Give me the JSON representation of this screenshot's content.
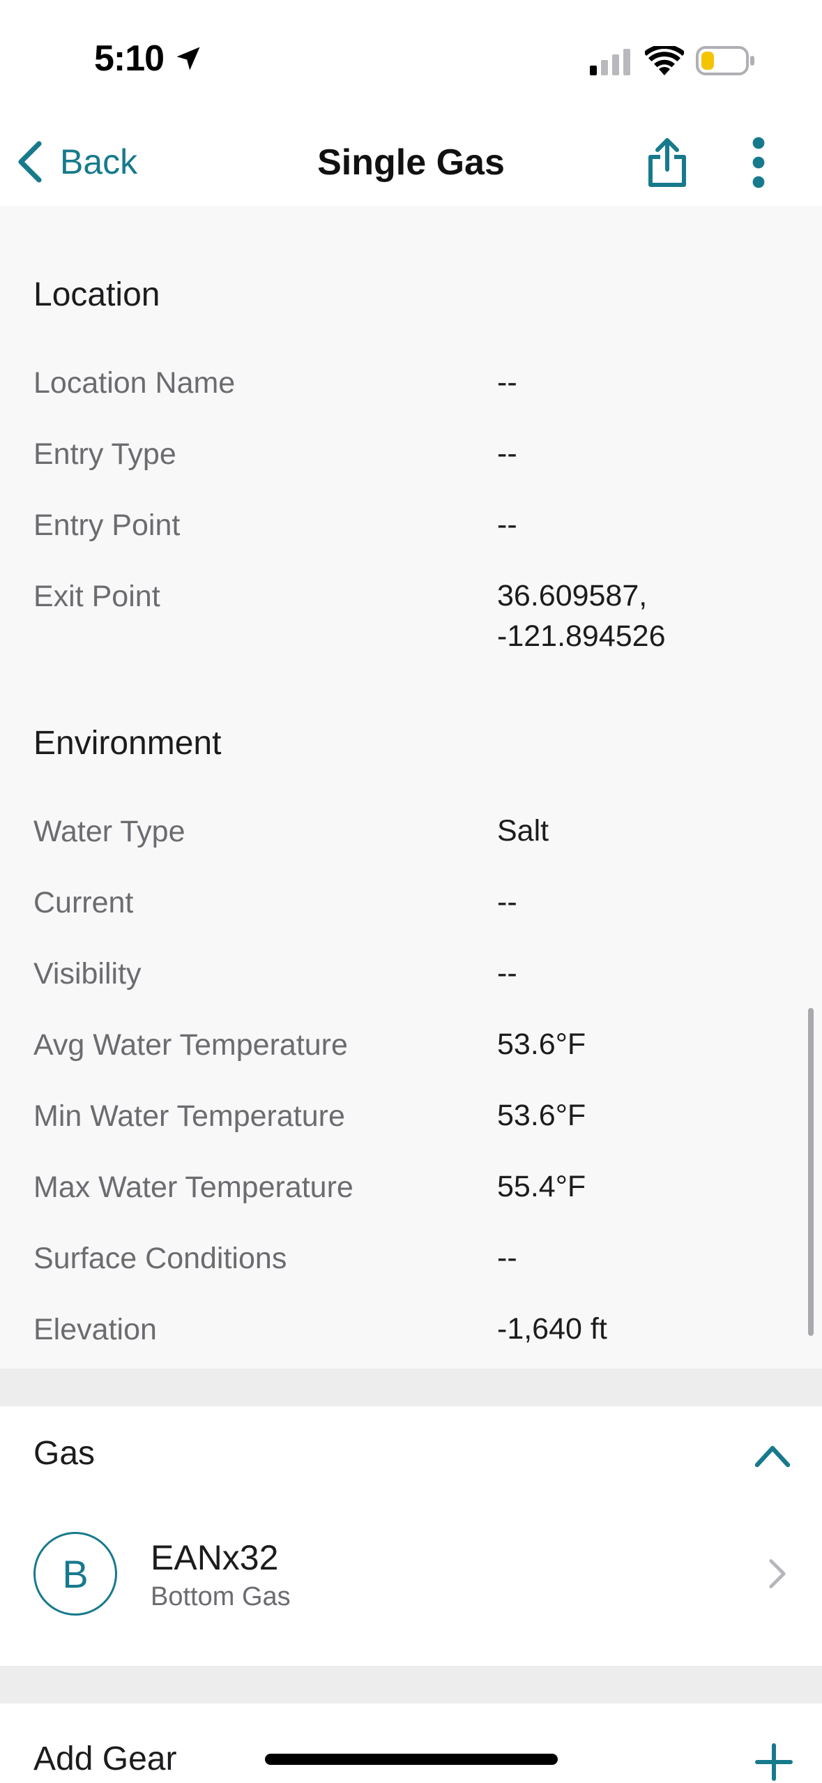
{
  "status_bar": {
    "time": "5:10",
    "battery_color": "#f5c400"
  },
  "nav": {
    "back_label": "Back",
    "title": "Single Gas",
    "accent_color": "#177a8c"
  },
  "location": {
    "title": "Location",
    "rows": [
      {
        "label": "Location Name",
        "value": "--"
      },
      {
        "label": "Entry Type",
        "value": "--"
      },
      {
        "label": "Entry Point",
        "value": "--"
      },
      {
        "label": "Exit Point",
        "value_line1": "36.609587,",
        "value_line2": "-121.894526"
      }
    ]
  },
  "environment": {
    "title": "Environment",
    "rows": [
      {
        "label": "Water Type",
        "value": "Salt"
      },
      {
        "label": "Current",
        "value": "--"
      },
      {
        "label": "Visibility",
        "value": "--"
      },
      {
        "label": "Avg Water Temperature",
        "value": "53.6°F"
      },
      {
        "label": "Min Water Temperature",
        "value": "53.6°F"
      },
      {
        "label": "Max Water Temperature",
        "value": "55.4°F"
      },
      {
        "label": "Surface Conditions",
        "value": "--"
      },
      {
        "label": "Elevation",
        "value": "-1,640 ft"
      }
    ]
  },
  "gas": {
    "title": "Gas",
    "items": [
      {
        "badge": "B",
        "name": "EANx32",
        "subtitle": "Bottom Gas"
      }
    ]
  },
  "gear": {
    "title": "Add Gear"
  }
}
